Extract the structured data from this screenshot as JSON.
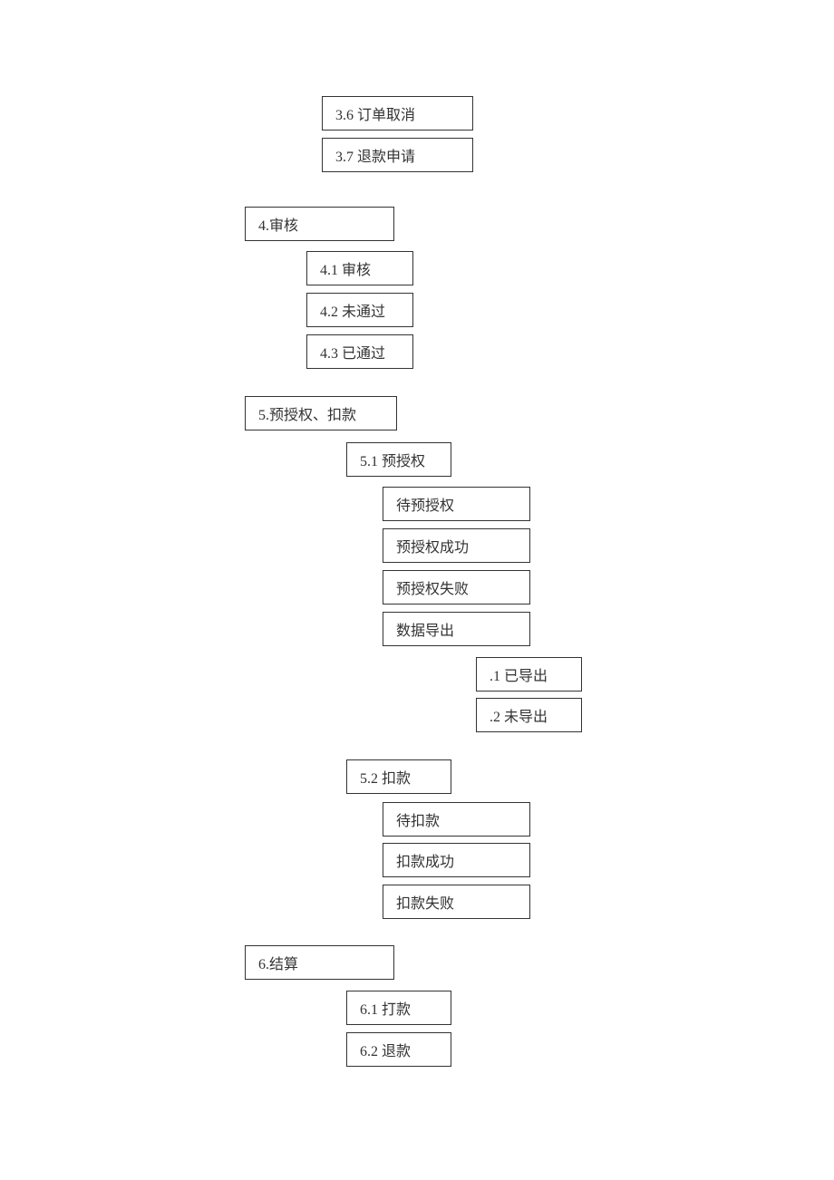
{
  "nodes": {
    "n_3_6": "3.6 订单取消",
    "n_3_7": "3.7 退款申请",
    "n_4": "4.审核",
    "n_4_1": "4.1 审核",
    "n_4_2": "4.2 未通过",
    "n_4_3": "4.3 已通过",
    "n_5": "5.预授权、扣款",
    "n_5_1": "5.1 预授权",
    "n_5_1_a": "待预授权",
    "n_5_1_b": "预授权成功",
    "n_5_1_c": "预授权失败",
    "n_5_1_d": "数据导出",
    "n_5_1_d_1": ".1 已导出",
    "n_5_1_d_2": ".2 未导出",
    "n_5_2": "5.2 扣款",
    "n_5_2_a": "待扣款",
    "n_5_2_b": "扣款成功",
    "n_5_2_c": "扣款失败",
    "n_6": "6.结算",
    "n_6_1": "6.1 打款",
    "n_6_2": "6.2 退款"
  }
}
